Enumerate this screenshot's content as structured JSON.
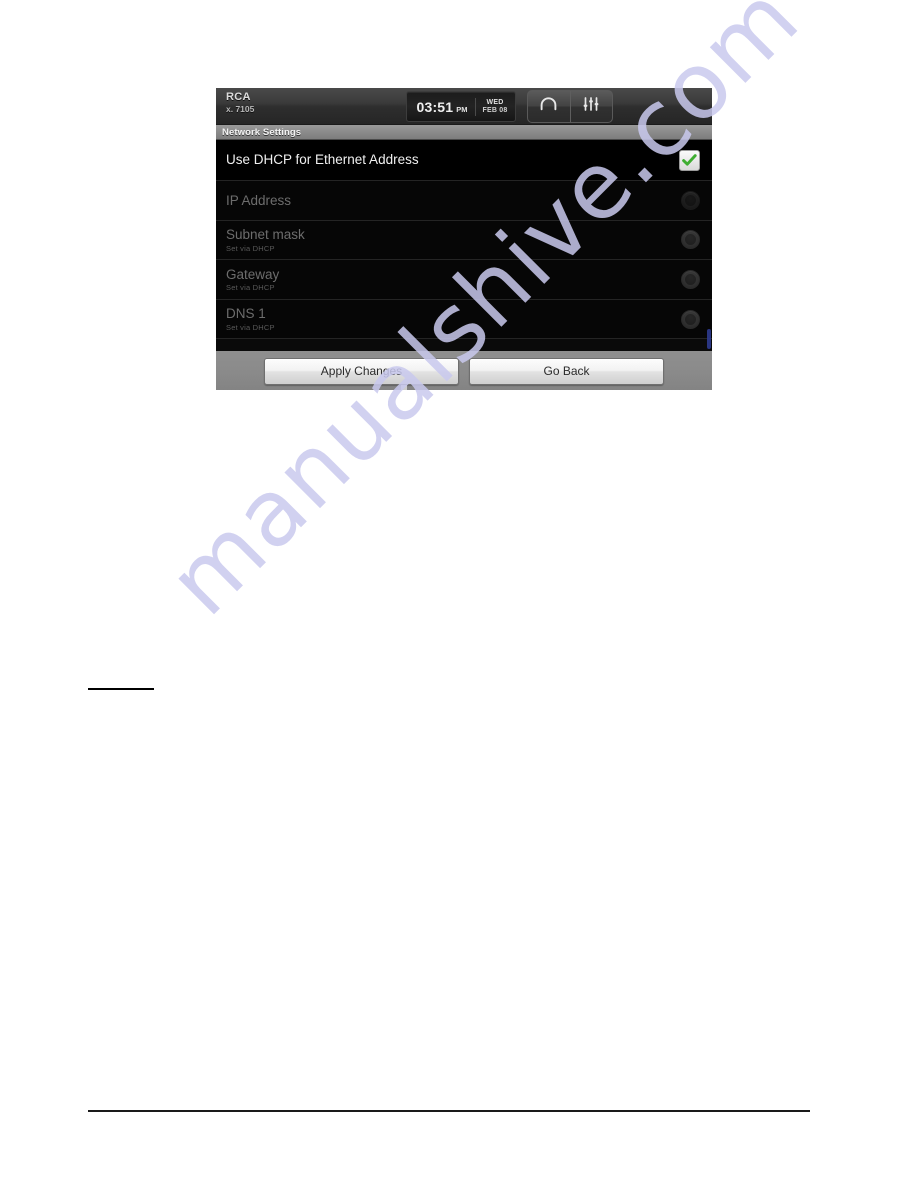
{
  "page": {
    "watermark_text": "manualshive.com",
    "watermark_color": "#c9c9ee",
    "background_color": "#ffffff"
  },
  "device": {
    "statusbar": {
      "brand_name": "RCA",
      "brand_extension": "x. 7105",
      "clock": {
        "time": "03:51",
        "ampm": "PM",
        "day_of_week": "WED",
        "month_day": "FEB 08"
      },
      "icons": [
        {
          "name": "headphone-icon",
          "label": "Headphones"
        },
        {
          "name": "equalizer-icon",
          "label": "Equalizer"
        }
      ]
    },
    "title_bar": {
      "title": "Network Settings"
    },
    "settings_rows": [
      {
        "title": "Use DHCP for Ethernet Address",
        "subtitle": "",
        "control": "checkbox",
        "checked": true,
        "enabled": true
      },
      {
        "title": "IP Address",
        "subtitle": "",
        "control": "radio",
        "checked": false,
        "enabled": false
      },
      {
        "title": "Subnet mask",
        "subtitle": "Set via DHCP",
        "control": "radio",
        "checked": false,
        "enabled": false
      },
      {
        "title": "Gateway",
        "subtitle": "Set via DHCP",
        "control": "radio",
        "checked": false,
        "enabled": false
      },
      {
        "title": "DNS 1",
        "subtitle": "Set via DHCP",
        "control": "radio",
        "checked": false,
        "enabled": false
      }
    ],
    "buttons": {
      "apply_label": "Apply Changes",
      "back_label": "Go Back"
    },
    "colors": {
      "checkbox_check": "#3fae32",
      "scroll_indicator": "#2e3b8f",
      "list_background": "#060606",
      "title_strip": "#8b8b8b"
    }
  }
}
